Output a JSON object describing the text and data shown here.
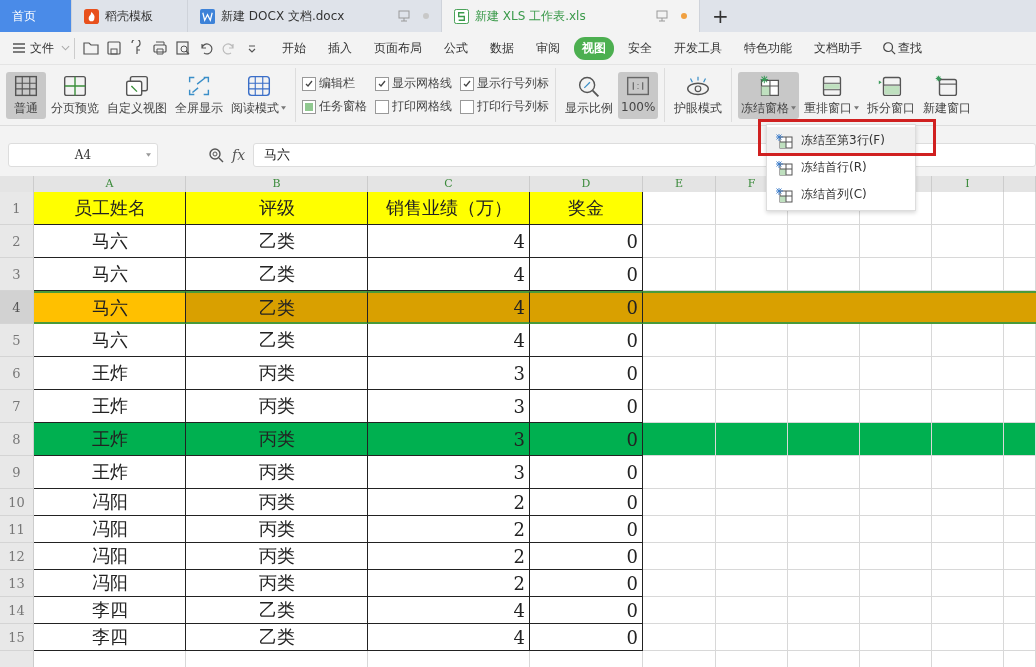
{
  "tabs": [
    {
      "kind": "home",
      "label": "首页",
      "selected": false
    },
    {
      "kind": "docer",
      "label": "稻壳模板",
      "selected": false
    },
    {
      "kind": "doc",
      "label": "新建 DOCX 文档.docx",
      "selected": false,
      "modified": false
    },
    {
      "kind": "xls",
      "label": "新建 XLS 工作表.xls",
      "selected": true,
      "modified": true
    }
  ],
  "new_tab": "+",
  "menu": {
    "file": "文件",
    "items": [
      {
        "label": "开始",
        "selected": false
      },
      {
        "label": "插入",
        "selected": false
      },
      {
        "label": "页面布局",
        "selected": false
      },
      {
        "label": "公式",
        "selected": false
      },
      {
        "label": "数据",
        "selected": false
      },
      {
        "label": "审阅",
        "selected": false
      },
      {
        "label": "视图",
        "selected": true
      },
      {
        "label": "安全",
        "selected": false
      },
      {
        "label": "开发工具",
        "selected": false
      },
      {
        "label": "特色功能",
        "selected": false
      },
      {
        "label": "文档助手",
        "selected": false
      }
    ],
    "search": "查找"
  },
  "ribbon": {
    "views": [
      {
        "kind": "grid",
        "label": "普通",
        "pressed": true,
        "dropdown": false
      },
      {
        "kind": "pages",
        "label": "分页预览",
        "pressed": false,
        "dropdown": false
      },
      {
        "kind": "custom",
        "label": "自定义视图",
        "pressed": false,
        "dropdown": false
      },
      {
        "kind": "fullscreen",
        "label": "全屏显示",
        "pressed": false,
        "dropdown": false
      },
      {
        "kind": "read",
        "label": "阅读模式",
        "pressed": false,
        "dropdown": true
      }
    ],
    "checkboxes": [
      {
        "label": "编辑栏",
        "checked": true,
        "kind": "tick"
      },
      {
        "label": "任务窗格",
        "checked": true,
        "kind": "square"
      },
      {
        "label": "显示网格线",
        "checked": true,
        "kind": "tick"
      },
      {
        "label": "打印网格线",
        "checked": false
      },
      {
        "label": "显示行号列标",
        "checked": true,
        "kind": "tick"
      },
      {
        "label": "打印行号列标",
        "checked": false
      }
    ],
    "zoom": [
      {
        "kind": "zoom",
        "label": "显示比例",
        "pressed": false,
        "dropdown": false
      },
      {
        "kind": "actual",
        "label": "100%",
        "pressed": true,
        "dropdown": false
      }
    ],
    "eye": [
      {
        "kind": "eye",
        "label": "护眼模式",
        "pressed": false,
        "dropdown": false
      }
    ],
    "windows": [
      {
        "kind": "freeze",
        "label": "冻结窗格",
        "pressed": true,
        "dropdown": true
      },
      {
        "kind": "arrange",
        "label": "重排窗口",
        "pressed": false,
        "dropdown": true
      },
      {
        "kind": "split",
        "label": "拆分窗口",
        "pressed": false,
        "dropdown": false
      },
      {
        "kind": "newwin",
        "label": "新建窗口",
        "pressed": false,
        "dropdown": false
      }
    ]
  },
  "formula_bar": {
    "name_box": "A4",
    "fx": "fx",
    "value": "马六"
  },
  "sheet": {
    "columns": [
      {
        "label": "A"
      },
      {
        "label": "B"
      },
      {
        "label": "C"
      },
      {
        "label": "D"
      },
      {
        "label": "E"
      },
      {
        "label": "F"
      },
      {},
      {},
      {
        "label": "I"
      }
    ],
    "rows": [
      {
        "number": "1",
        "cells": [
          "员工姓名",
          "评级",
          "销售业绩（万）",
          "奖金"
        ],
        "color": "#ffff00",
        "selected": false
      },
      {
        "number": "2",
        "cells": [
          "马六",
          "乙类",
          "4",
          "0"
        ],
        "color": "#ffffff",
        "selected": false
      },
      {
        "number": "3",
        "cells": [
          "马六",
          "乙类",
          "4",
          "0"
        ],
        "color": "#ffffff",
        "selected": false
      },
      {
        "number": "4",
        "cells": [
          "马六",
          "乙类",
          "4",
          "0"
        ],
        "color": "#d9a000",
        "selected": true
      },
      {
        "number": "5",
        "cells": [
          "马六",
          "乙类",
          "4",
          "0"
        ],
        "color": "#ffffff",
        "selected": false
      },
      {
        "number": "6",
        "cells": [
          "王炸",
          "丙类",
          "3",
          "0"
        ],
        "color": "#ffffff",
        "selected": false
      },
      {
        "number": "7",
        "cells": [
          "王炸",
          "丙类",
          "3",
          "0"
        ],
        "color": "#ffffff",
        "selected": false
      },
      {
        "number": "8",
        "cells": [
          "王炸",
          "丙类",
          "3",
          "0"
        ],
        "color": "#00b050",
        "selected": false
      },
      {
        "number": "9",
        "cells": [
          "王炸",
          "丙类",
          "3",
          "0"
        ],
        "color": "#ffffff",
        "selected": false
      },
      {
        "number": "10",
        "cells": [
          "冯阳",
          "丙类",
          "2",
          "0"
        ],
        "color": "#ffffff",
        "selected": false
      },
      {
        "number": "11",
        "cells": [
          "冯阳",
          "丙类",
          "2",
          "0"
        ],
        "color": "#ffffff",
        "selected": false
      },
      {
        "number": "12",
        "cells": [
          "冯阳",
          "丙类",
          "2",
          "0"
        ],
        "color": "#ffffff",
        "selected": false
      },
      {
        "number": "13",
        "cells": [
          "冯阳",
          "丙类",
          "2",
          "0"
        ],
        "color": "#ffffff",
        "selected": false
      },
      {
        "number": "14",
        "cells": [
          "李四",
          "乙类",
          "4",
          "0"
        ],
        "color": "#ffffff",
        "selected": false
      },
      {
        "number": "15",
        "cells": [
          "李四",
          "乙类",
          "4",
          "0"
        ],
        "color": "#ffffff",
        "selected": false
      }
    ]
  },
  "freeze_menu": [
    {
      "label": "冻结至第3行(F)",
      "selected": true
    },
    {
      "label": "冻结首行(R)",
      "selected": false
    },
    {
      "label": "冻结首列(C)",
      "selected": false
    }
  ]
}
